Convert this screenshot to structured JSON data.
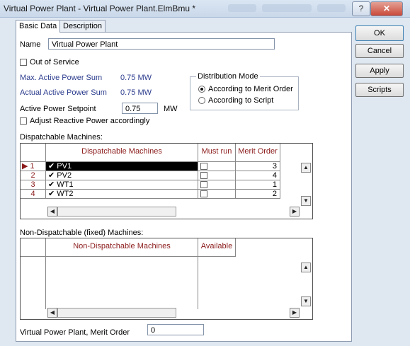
{
  "window": {
    "title": "Virtual Power Plant - Virtual Power Plant.ElmBmu *",
    "help_glyph": "?",
    "close_glyph": "✕"
  },
  "tabs": [
    {
      "label": "Basic Data",
      "active": true
    },
    {
      "label": "Description",
      "active": false
    }
  ],
  "form": {
    "name_label": "Name",
    "name_value": "Virtual Power Plant",
    "out_of_service_label": "Out of Service",
    "out_of_service_checked": false,
    "max_active_label": "Max. Active Power Sum",
    "max_active_value": "0.75 MW",
    "actual_active_label": "Actual Active Power Sum",
    "actual_active_value": "0.75 MW",
    "setpoint_label": "Active Power Setpoint",
    "setpoint_value": "0.75",
    "setpoint_unit": "MW",
    "adjust_reactive_label": "Adjust Reactive Power accordingly",
    "adjust_reactive_checked": false,
    "merit_order_label": "Virtual Power Plant, Merit Order",
    "merit_order_value": "0"
  },
  "distribution": {
    "label": "Distribution Mode",
    "options": [
      {
        "label": "According to Merit Order",
        "selected": true
      },
      {
        "label": "According to Script",
        "selected": false
      }
    ]
  },
  "dispatchable": {
    "section_label": "Dispatchable Machines:",
    "columns": [
      "Dispatchable Machines",
      "Must run",
      "Merit Order"
    ],
    "rows": [
      {
        "num": "1",
        "name": "PV1",
        "must_run": false,
        "merit": "3",
        "current": true
      },
      {
        "num": "2",
        "name": "PV2",
        "must_run": false,
        "merit": "4",
        "current": false
      },
      {
        "num": "3",
        "name": "WT1",
        "must_run": false,
        "merit": "1",
        "current": false
      },
      {
        "num": "4",
        "name": "WT2",
        "must_run": false,
        "merit": "2",
        "current": false
      }
    ],
    "row_marker": "▶",
    "row_check": "✔"
  },
  "non_dispatchable": {
    "section_label": "Non-Dispatchable (fixed) Machines:",
    "columns": [
      "Non-Dispatchable Machines",
      "Available"
    ],
    "rows": []
  },
  "scroll_glyphs": {
    "left": "◀",
    "right": "▶",
    "up": "▲",
    "down": "▼"
  },
  "buttons": {
    "ok": "OK",
    "cancel": "Cancel",
    "apply": "Apply",
    "scripts": "Scripts"
  }
}
